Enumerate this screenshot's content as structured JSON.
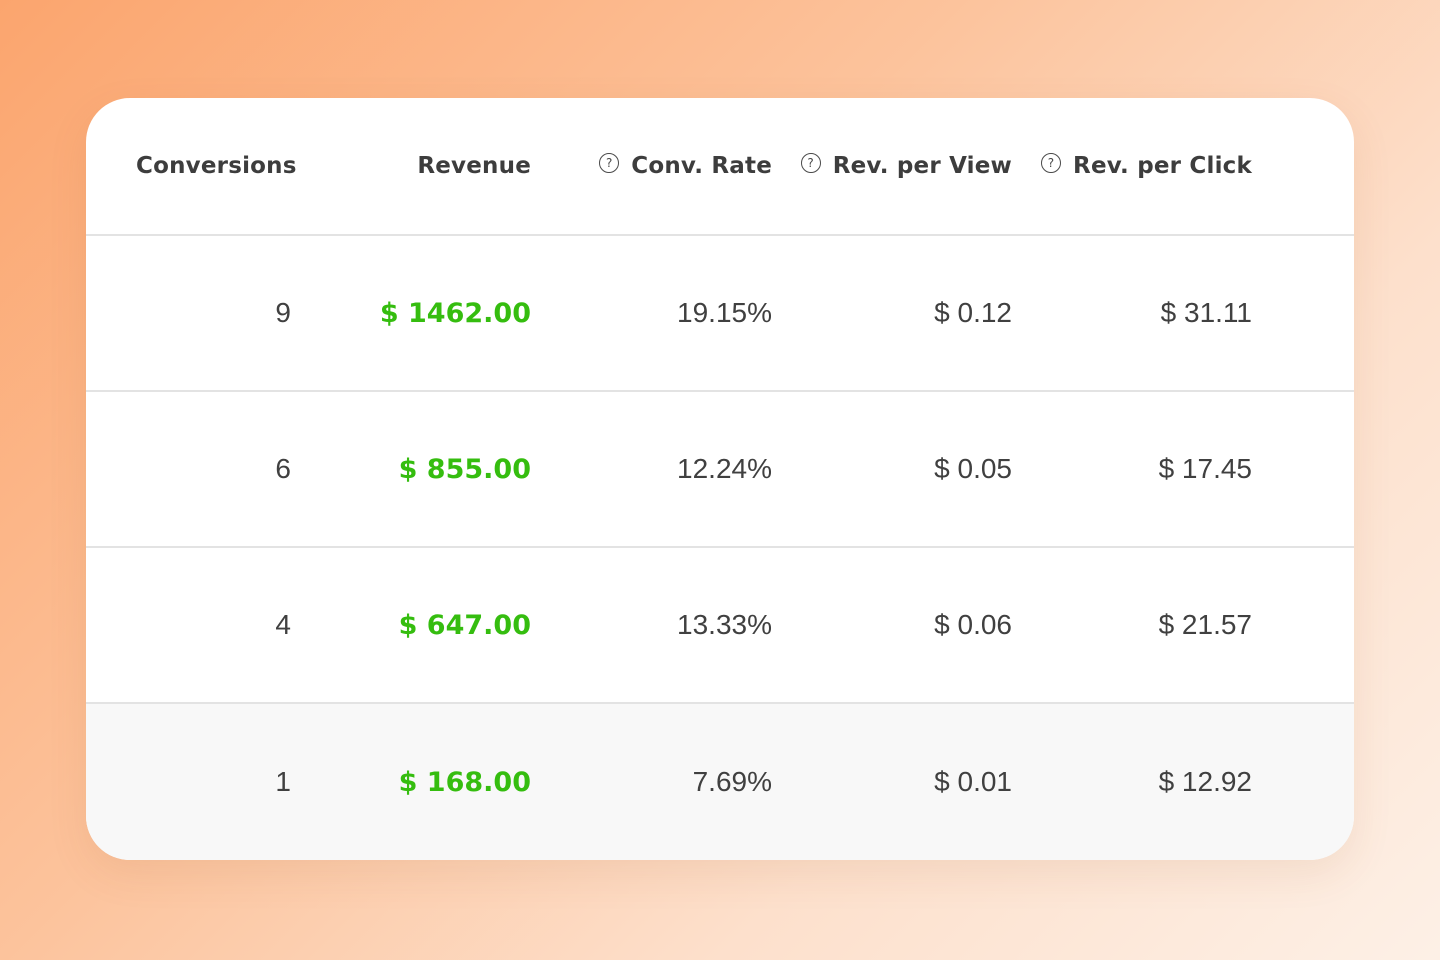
{
  "table": {
    "headers": [
      {
        "label": "Conversions",
        "help_icon": false
      },
      {
        "label": "Revenue",
        "help_icon": false
      },
      {
        "label": "Conv. Rate",
        "help_icon": true
      },
      {
        "label": "Rev. per View",
        "help_icon": true
      },
      {
        "label": "Rev. per Click",
        "help_icon": true
      }
    ],
    "help_glyph": "?",
    "rows": [
      {
        "conversions": "9",
        "revenue": "$ 1462.00",
        "conv_rate": "19.15%",
        "rev_per_view": "$ 0.12",
        "rev_per_click": "$ 31.11"
      },
      {
        "conversions": "6",
        "revenue": "$ 855.00",
        "conv_rate": "12.24%",
        "rev_per_view": "$ 0.05",
        "rev_per_click": "$ 17.45"
      },
      {
        "conversions": "4",
        "revenue": "$ 647.00",
        "conv_rate": "13.33%",
        "rev_per_view": "$ 0.06",
        "rev_per_click": "$ 21.57"
      },
      {
        "conversions": "1",
        "revenue": "$ 168.00",
        "conv_rate": "7.69%",
        "rev_per_view": "$ 0.01",
        "rev_per_click": "$ 12.92"
      }
    ]
  },
  "colors": {
    "revenue_text": "#35bd0f",
    "highlighted_row_bg": "#f8f8f8",
    "header_text": "#3d3d3d",
    "body_text": "#404040"
  }
}
